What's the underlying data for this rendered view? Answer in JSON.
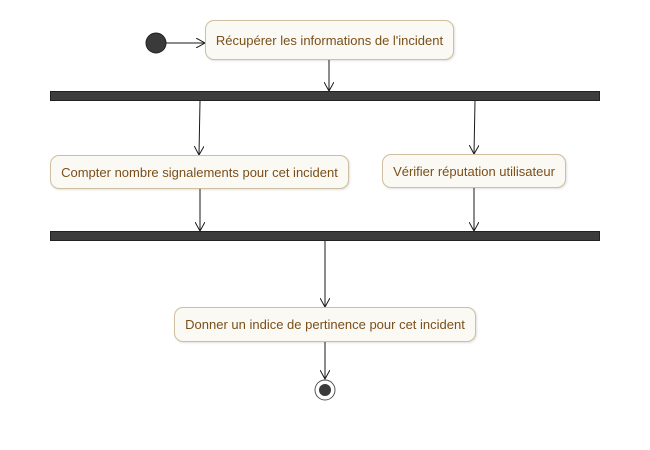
{
  "diagram": {
    "colors": {
      "node_fill": "#fbf9f3",
      "node_border": "#cdbf9f",
      "node_text": "#7a4f1a",
      "bar": "#3d3d3d",
      "edge": "#1a1a1a"
    },
    "nodes": {
      "start": {
        "type": "initial"
      },
      "retrieve": {
        "label": "Récupérer les informations de l'incident"
      },
      "fork": {
        "type": "fork"
      },
      "count": {
        "label": "Compter nombre signalements pour cet incident"
      },
      "verify": {
        "label": "Vérifier réputation utilisateur"
      },
      "join": {
        "type": "join"
      },
      "relevance": {
        "label": "Donner un indice de pertinence pour cet incident"
      },
      "end": {
        "type": "final"
      }
    },
    "edges": [
      {
        "from": "start",
        "to": "retrieve"
      },
      {
        "from": "retrieve",
        "to": "fork"
      },
      {
        "from": "fork",
        "to": "count"
      },
      {
        "from": "fork",
        "to": "verify"
      },
      {
        "from": "count",
        "to": "join"
      },
      {
        "from": "verify",
        "to": "join"
      },
      {
        "from": "join",
        "to": "relevance"
      },
      {
        "from": "relevance",
        "to": "end"
      }
    ]
  }
}
